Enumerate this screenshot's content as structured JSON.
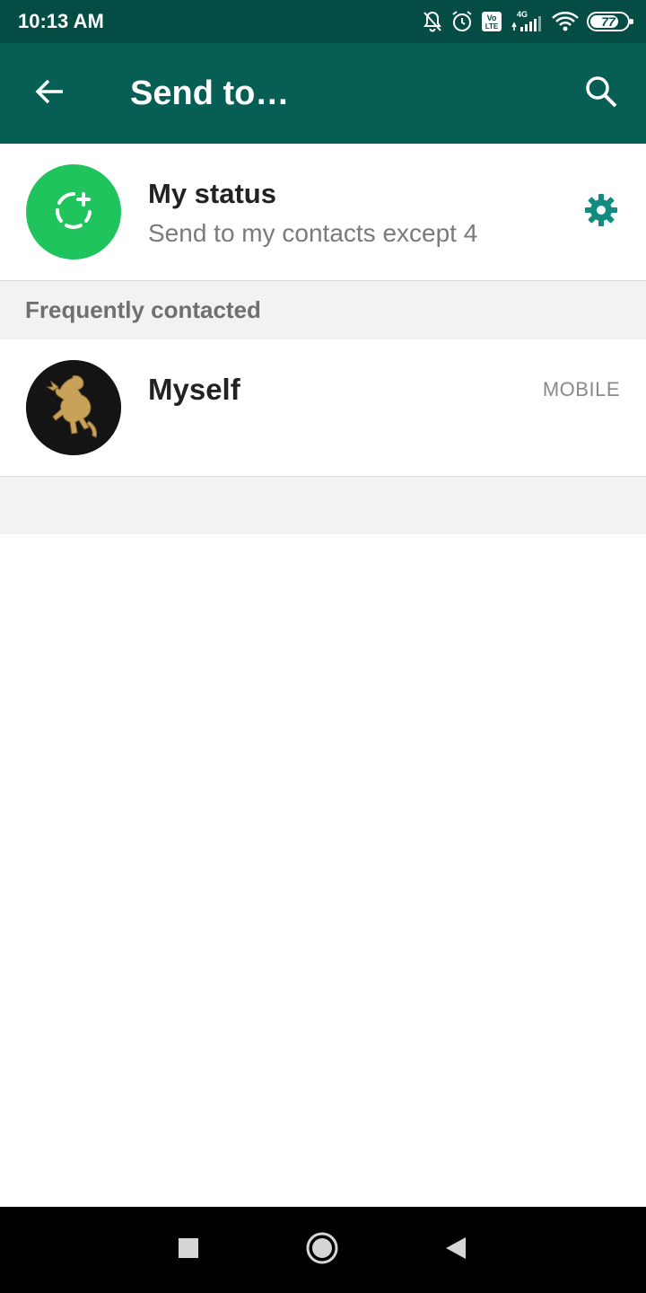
{
  "status_bar": {
    "time": "10:13 AM",
    "network": "4G",
    "volte": "Vo LTE",
    "battery": "77",
    "battery_level_percent": 77,
    "icons": [
      "bell-off-icon",
      "alarm-icon",
      "volte-icon",
      "signal-icon",
      "wifi-icon",
      "battery-icon"
    ]
  },
  "app_bar": {
    "title": "Send to…",
    "back_icon": "arrow-back-icon",
    "search_icon": "search-icon"
  },
  "my_status": {
    "title": "My status",
    "subtitle": "Send to my contacts except 4",
    "avatar_icon": "add-status-icon",
    "settings_icon": "gear-icon"
  },
  "section": {
    "title": "Frequently contacted"
  },
  "contacts": [
    {
      "name": "Myself",
      "type": "MOBILE",
      "avatar_icon": "lion-emblem-icon"
    }
  ],
  "nav_bar": {
    "icons": [
      "recents-square-icon",
      "home-circle-icon",
      "back-triangle-icon"
    ]
  },
  "colors": {
    "status_bar": "#054d44",
    "app_bar": "#075e54",
    "status_avatar": "#1fc45c",
    "accent_teal": "#128c7e",
    "section_bg": "#f2f2f2",
    "nav_bar": "#000000"
  }
}
